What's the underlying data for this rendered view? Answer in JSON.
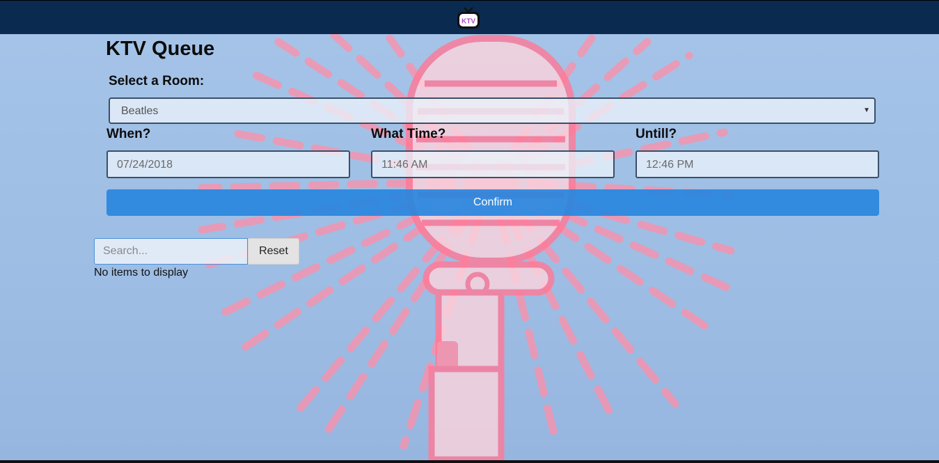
{
  "header": {
    "logo_text": "KTV",
    "logo_icon": "tv-icon"
  },
  "page": {
    "title": "KTV Queue"
  },
  "form": {
    "room_label": "Select a Room:",
    "room_value": "Beatles",
    "when_label": "When?",
    "when_value": "07/24/2018",
    "time_label": "What Time?",
    "time_value": "11:46 AM",
    "until_label": "Untill?",
    "until_value": "12:46 PM",
    "confirm_label": "Confirm"
  },
  "queue": {
    "search_placeholder": "Search...",
    "reset_label": "Reset",
    "empty_text": "No items to display"
  },
  "colors": {
    "navbar": "#0b2a4f",
    "confirm": "#2887de",
    "background": "#a6c4e8",
    "art": "#ff8fa8"
  }
}
